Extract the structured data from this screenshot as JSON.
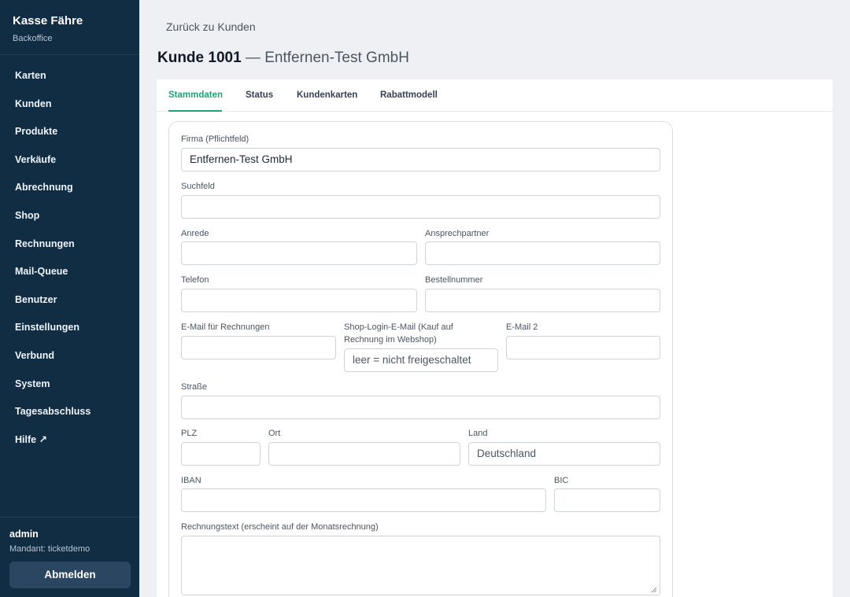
{
  "brand": {
    "title": "Kasse Fähre",
    "subtitle": "Backoffice"
  },
  "nav": {
    "karten": "Karten",
    "kunden": "Kunden",
    "produkte": "Produkte",
    "verkaeufe": "Verkäufe",
    "abrechnung": "Abrechnung",
    "shop": "Shop",
    "rechnungen": "Rechnungen",
    "mailqueue": "Mail-Queue",
    "benutzer": "Benutzer",
    "einstellungen": "Einstellungen",
    "verbund": "Verbund",
    "system": "System",
    "tagesabschluss": "Tagesabschluss",
    "hilfe": "Hilfe ↗"
  },
  "user": {
    "name": "admin",
    "tenant": "Mandant: ticketdemo",
    "logout_label": "Abmelden"
  },
  "back_link": "Zurück zu Kunden",
  "title": {
    "number": "Kunde 1001",
    "rest": " — Entfernen-Test GmbH"
  },
  "tabs": {
    "stammdaten": "Stammdaten",
    "status": "Status",
    "kundenkarten": "Kundenkarten",
    "rabattmodell": "Rabattmodell",
    "active": "Stammdaten"
  },
  "form": {
    "firma": {
      "label": "Firma (Pflichtfeld)",
      "value": "Entfernen-Test GmbH"
    },
    "suchfeld": {
      "label": "Suchfeld",
      "value": ""
    },
    "anrede": {
      "label": "Anrede",
      "value": ""
    },
    "ansprechpartner": {
      "label": "Ansprechpartner",
      "value": ""
    },
    "telefon": {
      "label": "Telefon",
      "value": ""
    },
    "bestellnummer": {
      "label": "Bestellnummer",
      "value": ""
    },
    "email_rechnungen": {
      "label": "E-Mail für Rechnungen",
      "value": ""
    },
    "shop_login": {
      "label_line1": "Shop-Login-E-Mail (Kauf auf",
      "label_line2": "Rechnung im Webshop)",
      "placeholder": "leer = nicht freigeschaltet"
    },
    "email2": {
      "label": "E-Mail 2",
      "value": ""
    },
    "strasse": {
      "label": "Straße",
      "value": ""
    },
    "plz": {
      "label": "PLZ",
      "value": ""
    },
    "ort": {
      "label": "Ort",
      "value": ""
    },
    "land": {
      "label": "Land",
      "value": "Deutschland"
    },
    "iban": {
      "label": "IBAN",
      "value": ""
    },
    "bic": {
      "label": "BIC",
      "value": ""
    },
    "rechnungstext": {
      "label": "Rechnungstext (erscheint auf der Monatsrechnung)",
      "value": ""
    }
  },
  "colors": {
    "sidebar": "#112d44",
    "accent": "#1fa37a"
  }
}
